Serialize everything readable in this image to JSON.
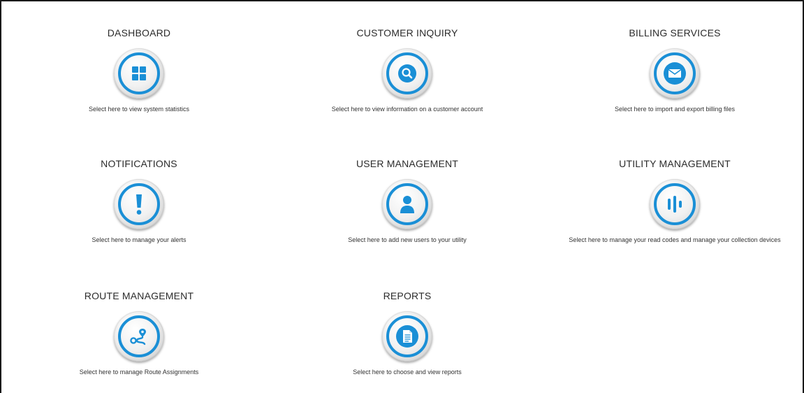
{
  "tiles": [
    {
      "title": "DASHBOARD",
      "description": "Select here to view system statistics",
      "icon": "grid-icon"
    },
    {
      "title": "CUSTOMER INQUIRY",
      "description": "Select here to view information on a customer account",
      "icon": "search-icon"
    },
    {
      "title": "BILLING SERVICES",
      "description": "Select here to import and export billing files",
      "icon": "envelope-icon"
    },
    {
      "title": "NOTIFICATIONS",
      "description": "Select here to manage your alerts",
      "icon": "exclamation-icon"
    },
    {
      "title": "USER MANAGEMENT",
      "description": "Select here to add new users to your utility",
      "icon": "user-icon"
    },
    {
      "title": "UTILITY MANAGEMENT",
      "description": "Select here to manage your read codes and manage your collection devices",
      "icon": "signal-bars-icon"
    },
    {
      "title": "ROUTE MANAGEMENT",
      "description": "Select here to manage Route Assignments",
      "icon": "route-icon"
    },
    {
      "title": "REPORTS",
      "description": "Select here to choose and view reports",
      "icon": "document-icon"
    }
  ],
  "colors": {
    "accent": "#1a8fd6",
    "text": "#2b2b2b"
  }
}
